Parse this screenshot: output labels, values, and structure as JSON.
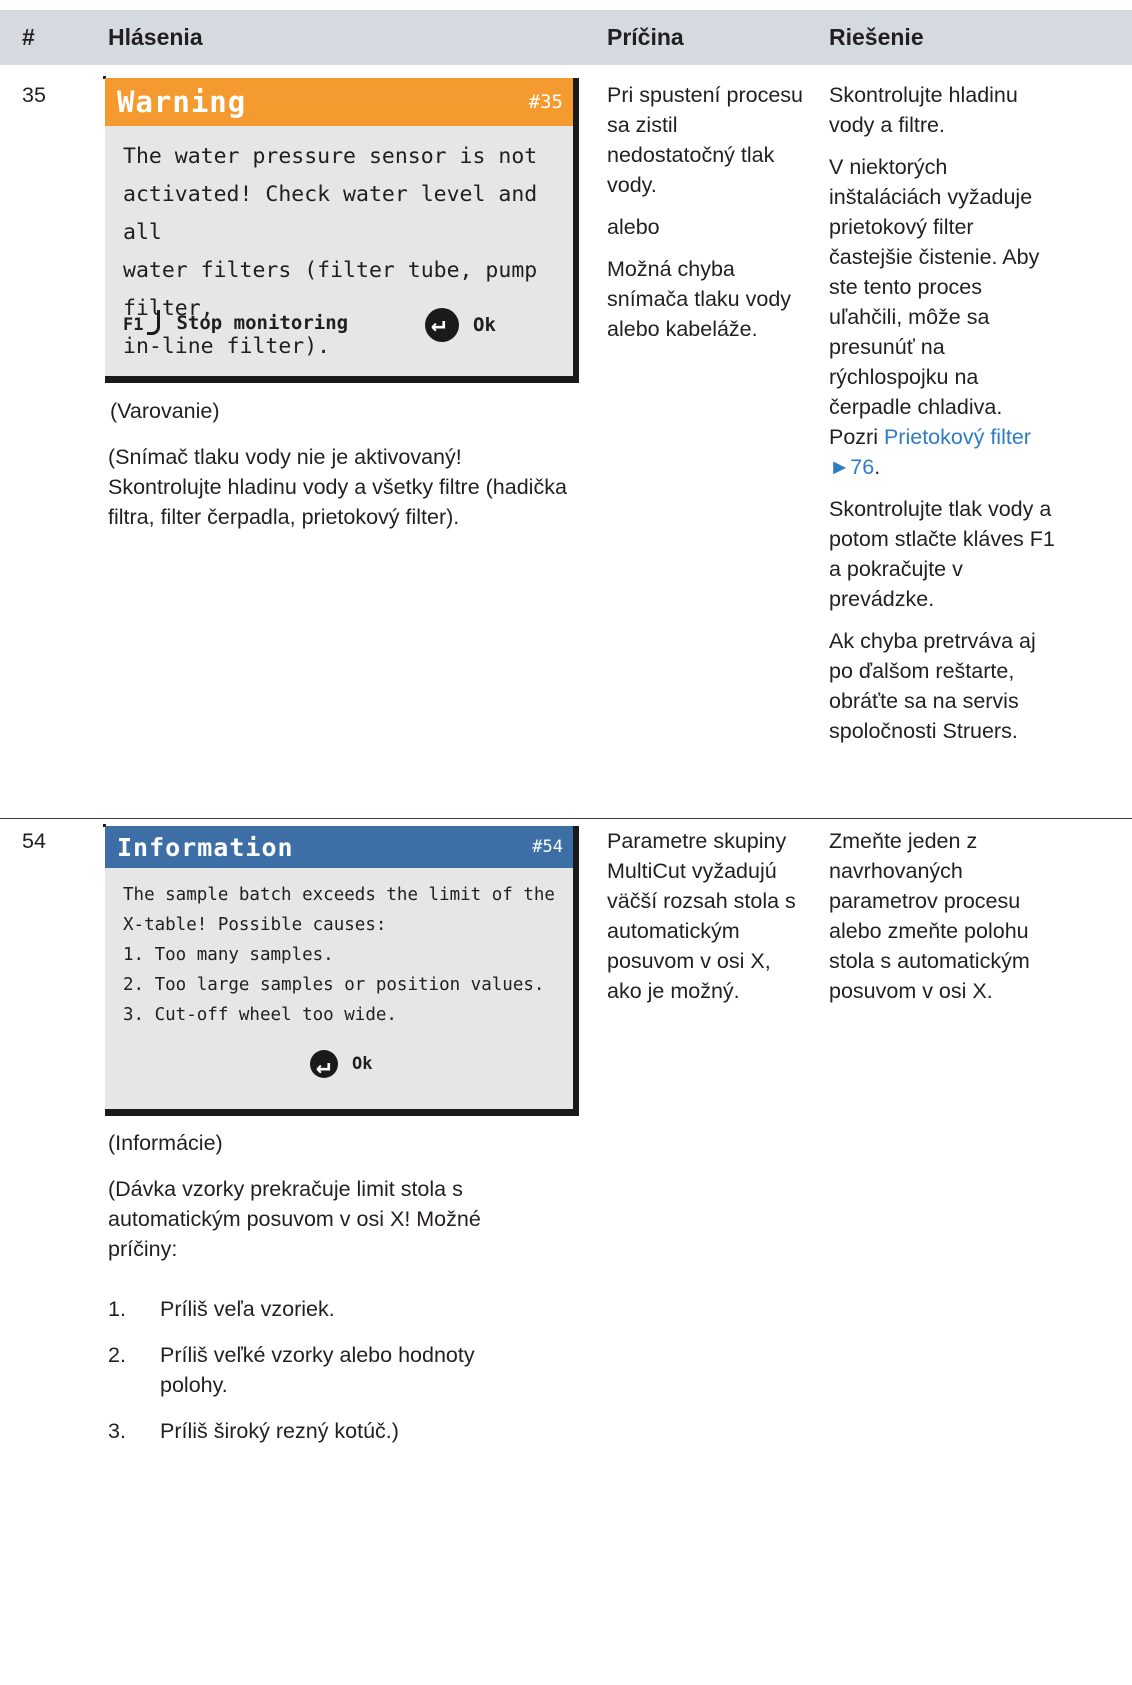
{
  "table_header": {
    "col_num": "#",
    "col_messages": "Hlásenia",
    "col_cause": "Príčina",
    "col_solution": "Riešenie"
  },
  "rows": [
    {
      "number": "35",
      "screen": {
        "title": "Warning",
        "code": "#35",
        "title_color": "#f59a2f",
        "lines": [
          "The water pressure sensor is not",
          "activated! Check water level and all",
          "water filters (filter tube, pump filter,",
          "in-line filter)."
        ],
        "f1_label": "F1",
        "f1_action": "Stop monitoring",
        "ok_label": "Ok"
      },
      "translation_title": "(Varovanie)",
      "translation_body": "(Snímač tlaku vody nie je aktivovaný! Skontrolujte hladinu vody a všetky filtre (hadička filtra, filter čerpadla, prietokový filter).",
      "cause": [
        "Pri spustení procesu sa zistil nedostatočný tlak vody.",
        "alebo",
        "Možná chyba snímača tlaku vody alebo kabeláže."
      ],
      "solution": {
        "p1": "Skontrolujte hladinu vody a filtre.",
        "p2_text": "V niektorých inštaláciách vyžaduje prietokový filter častejšie čistenie. Aby ste tento proces uľahčili, môže sa presunúť na rýchlospojku na čerpadle chladiva. Pozri ",
        "p2_link": "Prietokový filter ►76",
        "p2_end": ".",
        "p3": "Skontrolujte tlak vody a potom stlačte kláves F1 a pokračujte v prevádzke.",
        "p4": "Ak chyba pretrváva aj po ďalšom reštarte, obráťte sa na servis spoločnosti Struers."
      }
    },
    {
      "number": "54",
      "screen": {
        "title": "Information",
        "code": "#54",
        "title_color": "#3d6ea6",
        "lines": [
          "The sample batch exceeds the limit of the",
          "X-table! Possible causes:",
          "1. Too many samples.",
          "2. Too large samples or position values.",
          "3. Cut-off wheel too wide."
        ],
        "ok_label": "Ok"
      },
      "translation_title": "(Informácie)",
      "translation_body": "(Dávka vzorky prekračuje limit stola s automatickým posuvom v osi X! Možné príčiny:",
      "list": [
        {
          "n": "1.",
          "t": "Príliš veľa vzoriek."
        },
        {
          "n": "2.",
          "t": "Príliš veľké vzorky alebo hodnoty polohy."
        },
        {
          "n": "3.",
          "t": "Príliš široký rezný kotúč.)"
        }
      ],
      "cause": "Parametre skupiny MultiCut vyžadujú väčší rozsah stola s automatickým posuvom v osi X, ako je možný.",
      "solution": "Zmeňte jeden z navrhovaných parametrov procesu alebo zmeňte polohu stola s automatickým posuvom v osi X."
    }
  ]
}
